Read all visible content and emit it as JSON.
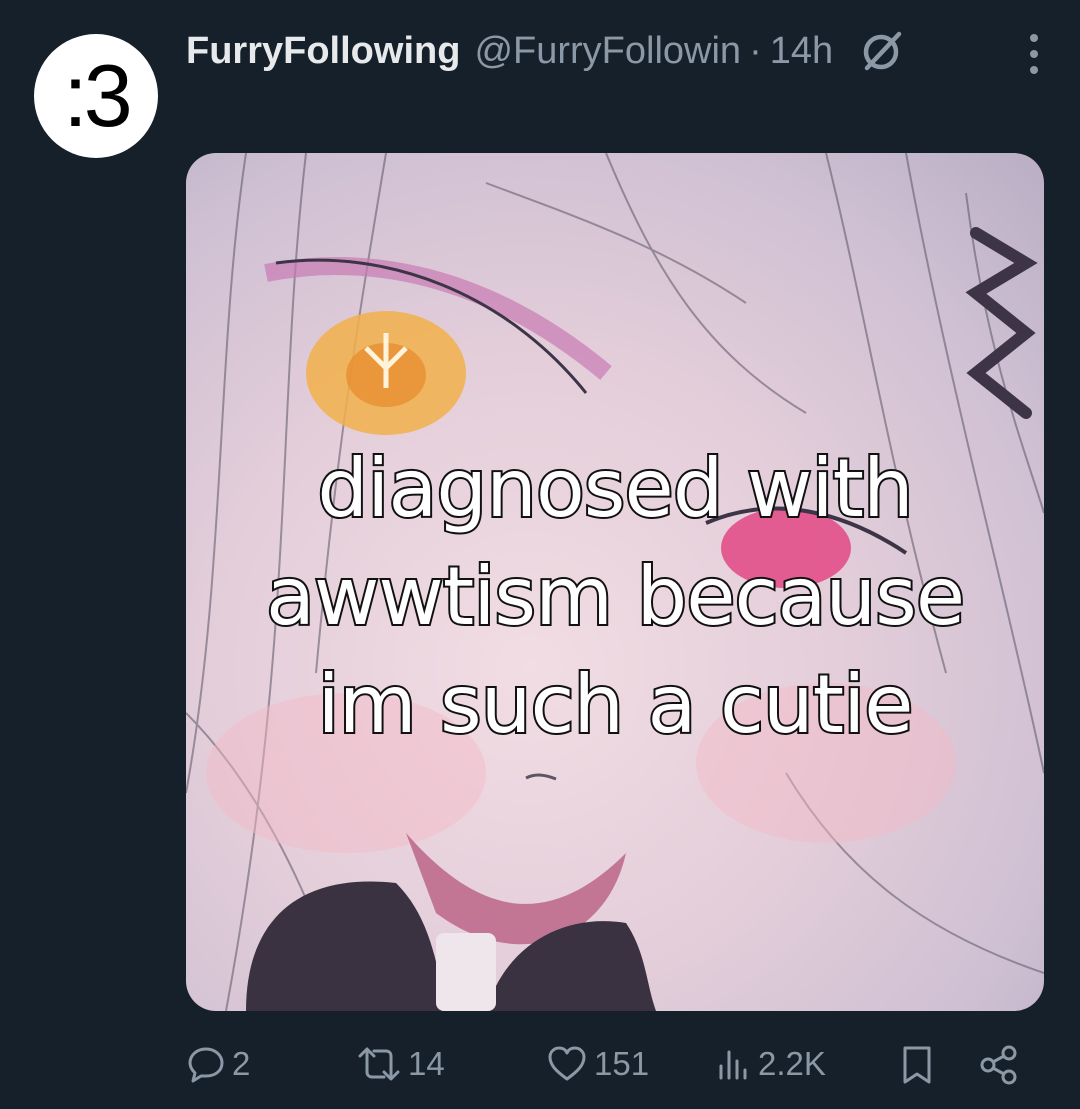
{
  "tweet": {
    "avatar_text": ":3",
    "display_name": "FurryFollowing",
    "handle": "@FurryFollowin",
    "separator": "·",
    "time": "14h",
    "media": {
      "caption_lines": [
        "diagnosed with",
        "awwtism because",
        "im such a cutie"
      ]
    },
    "actions": {
      "replies": "2",
      "retweets": "14",
      "likes": "151",
      "views": "2.2K"
    }
  },
  "colors": {
    "background": "#15202b",
    "text_primary": "#e7e9ea",
    "text_secondary": "#8b98a5",
    "avatar_bg": "#ffffff"
  },
  "icons": [
    "grok-icon",
    "more-icon",
    "reply-icon",
    "retweet-icon",
    "like-icon",
    "views-icon",
    "bookmark-icon",
    "share-icon"
  ]
}
